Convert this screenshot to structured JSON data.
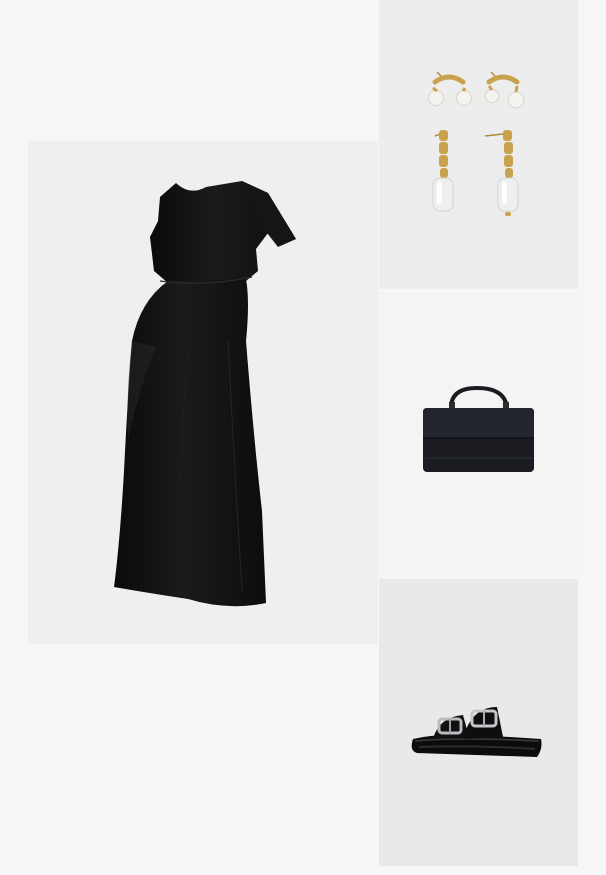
{
  "outfit": {
    "items": [
      {
        "id": "dress",
        "product": "maternity-dress",
        "color": "#111111"
      },
      {
        "id": "earrings",
        "product": "pearl-drop-earrings",
        "color": "#c9a24e"
      },
      {
        "id": "bag",
        "product": "clutch-bag",
        "color": "#1a1c22"
      },
      {
        "id": "sandals",
        "product": "buckle-sandals",
        "color": "#0c0c0c"
      }
    ],
    "background_color": "#f6f6f6"
  }
}
